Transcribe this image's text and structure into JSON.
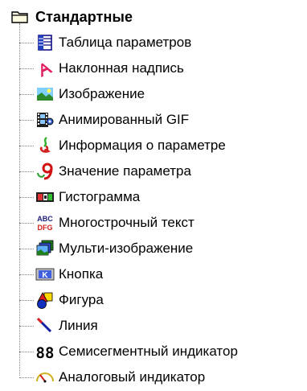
{
  "tree": {
    "root": {
      "label": "Стандартные",
      "icon": "folder-icon"
    },
    "items": [
      {
        "label": "Таблица параметров",
        "icon": "table-icon"
      },
      {
        "label": "Наклонная надпись",
        "icon": "slanted-text-icon"
      },
      {
        "label": "Изображение",
        "icon": "image-icon"
      },
      {
        "label": "Анимированный GIF",
        "icon": "film-icon"
      },
      {
        "label": "Информация о параметре",
        "icon": "parameter-info-icon"
      },
      {
        "label": "Значение параметра",
        "icon": "parameter-value-icon"
      },
      {
        "label": "Гистограмма",
        "icon": "histogram-icon"
      },
      {
        "label": "Многострочный текст",
        "icon": "multiline-text-icon",
        "icon_text_top": "ABC",
        "icon_text_bottom": "DFG"
      },
      {
        "label": "Мульти-изображение",
        "icon": "multi-image-icon"
      },
      {
        "label": "Кнопка",
        "icon": "button-icon",
        "icon_text": "K"
      },
      {
        "label": "Фигура",
        "icon": "shape-icon"
      },
      {
        "label": "Линия",
        "icon": "line-icon"
      },
      {
        "label": "Семисегментный индикатор",
        "icon": "seven-segment-icon",
        "icon_text": "88"
      },
      {
        "label": "Аналоговый индикатор",
        "icon": "analog-gauge-icon"
      }
    ]
  }
}
